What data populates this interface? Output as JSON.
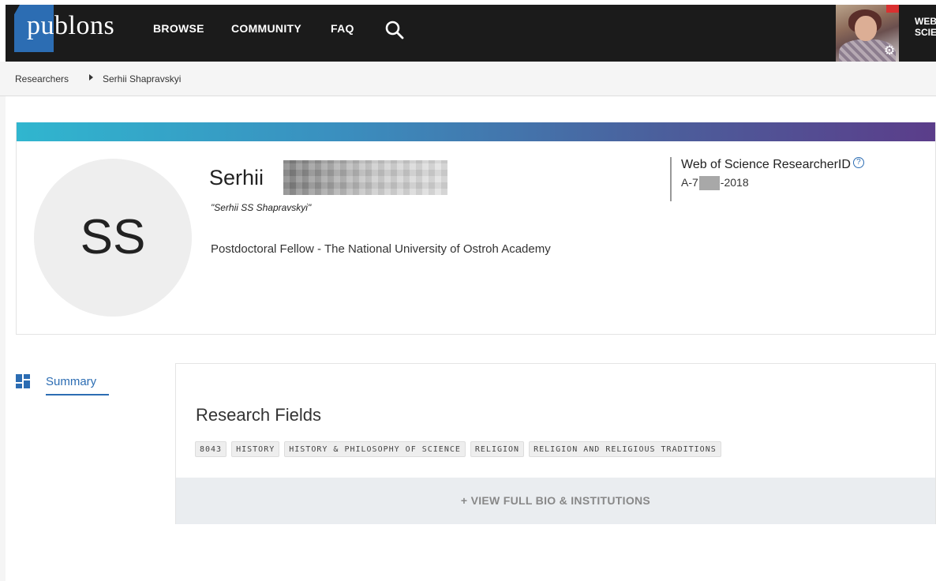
{
  "header": {
    "logo_text": "publons",
    "nav": [
      "BROWSE",
      "COMMUNITY",
      "FAQ"
    ],
    "wos_line1": "WEB",
    "wos_line2": "SCIE"
  },
  "breadcrumb": {
    "items": [
      "Researchers",
      "Serhii Shapravskyi"
    ]
  },
  "profile": {
    "initials": "SS",
    "first_name": "Serhii",
    "alias": "\"Serhii SS Shapravskyi\"",
    "position": "Postdoctoral Fellow - The National University of Ostroh Academy",
    "researcher_id_label": "Web of Science ResearcherID",
    "researcher_id_prefix": "A-7",
    "researcher_id_suffix": "-2018"
  },
  "sidenav": {
    "summary_label": "Summary"
  },
  "research_fields": {
    "title": "Research Fields",
    "tags": [
      "8043",
      "HISTORY",
      "HISTORY & PHILOSOPHY OF SCIENCE",
      "RELIGION",
      "RELIGION AND RELIGIOUS TRADITIONS"
    ],
    "view_bio_label": "+ VIEW FULL BIO & INSTITUTIONS"
  },
  "colors": {
    "header_bg": "#1b1b1b",
    "logo_blue": "#2c6db3",
    "link_blue": "#2c6db3",
    "gradient_start": "#30b6cf",
    "gradient_end": "#5b3d8a"
  }
}
